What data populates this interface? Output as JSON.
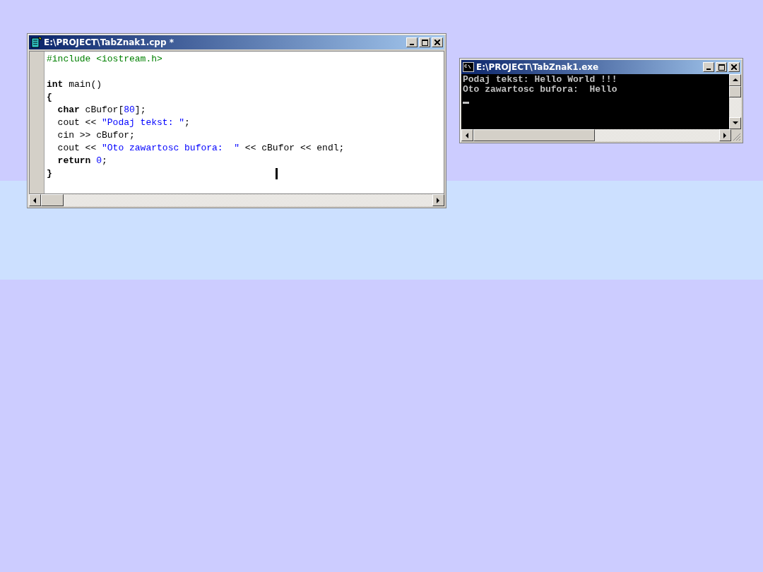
{
  "editor": {
    "title": "E:\\PROJECT\\TabZnak1.cpp *",
    "paragraphs": [
      {
        "lines": [
          {
            "indented": false,
            "tokens": [
              {
                "text": "#include <iostream.h>",
                "kind": "preprocessor"
              }
            ]
          }
        ]
      },
      {
        "lines": [
          {
            "indented": false,
            "tokens": [
              {
                "text": "int",
                "kind": "keyword"
              },
              {
                "text": " main()",
                "kind": "plain"
              }
            ]
          },
          {
            "indented": false,
            "tokens": [
              {
                "text": "{",
                "kind": "keyword"
              }
            ]
          },
          {
            "indented": true,
            "tokens": [
              {
                "text": "char",
                "kind": "keyword"
              },
              {
                "text": " cBufor[",
                "kind": "plain"
              },
              {
                "text": "80",
                "kind": "number"
              },
              {
                "text": "];",
                "kind": "plain"
              }
            ]
          },
          {
            "indented": true,
            "tokens": [
              {
                "text": "cout << ",
                "kind": "plain"
              },
              {
                "text": "\"Podaj tekst: \"",
                "kind": "string"
              },
              {
                "text": ";",
                "kind": "plain"
              }
            ]
          },
          {
            "indented": true,
            "tokens": [
              {
                "text": "cin >> cBufor;",
                "kind": "plain"
              }
            ]
          },
          {
            "indented": true,
            "tokens": [
              {
                "text": "cout << ",
                "kind": "plain"
              },
              {
                "text": "\"Oto zawartosc bufora:  \"",
                "kind": "string"
              },
              {
                "text": " << cBufor << endl;",
                "kind": "plain"
              }
            ]
          },
          {
            "indented": true,
            "tokens": [
              {
                "text": "return ",
                "kind": "keyword"
              },
              {
                "text": "0",
                "kind": "number"
              },
              {
                "text": ";",
                "kind": "plain"
              }
            ]
          },
          {
            "indented": false,
            "tokens": [
              {
                "text": "}",
                "kind": "keyword"
              }
            ]
          }
        ]
      }
    ]
  },
  "console": {
    "title": "E:\\PROJECT\\TabZnak1.exe",
    "lines": [
      "Podaj tekst: Hello World !!!",
      "Oto zawartosc bufora:  Hello"
    ]
  }
}
